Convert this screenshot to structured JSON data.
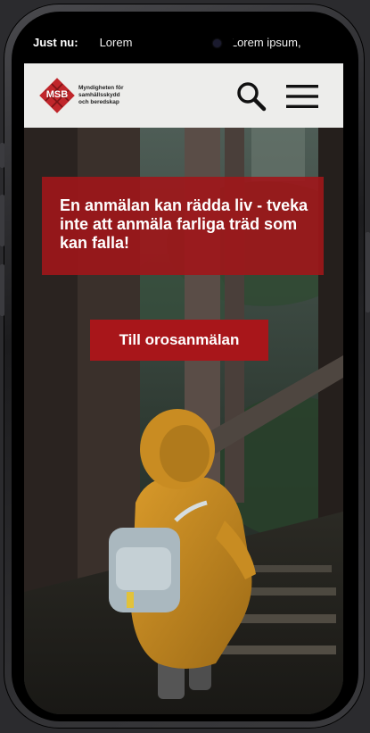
{
  "ticker": {
    "label": "Just nu:",
    "items": [
      "Lorem ipsum, dolor",
      "Lorem ipsum,"
    ]
  },
  "logo": {
    "abbreviation": "MSB",
    "name_lines": [
      "Myndigheten för",
      "samhällsskydd",
      "och beredskap"
    ]
  },
  "hero": {
    "headline": "En anmälan kan rädda liv - tveka inte att anmäla farliga träd som kan falla!",
    "cta_label": "Till orosanmälan"
  },
  "colors": {
    "brand_red": "#a8161a",
    "header_bg": "#ededeb",
    "ticker_bg": "#000000"
  },
  "icons": {
    "search": "search-icon",
    "menu": "hamburger-menu-icon"
  }
}
